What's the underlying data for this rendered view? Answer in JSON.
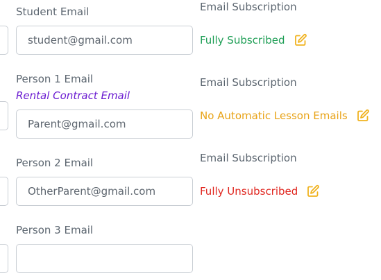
{
  "student": {
    "label": "Student Email",
    "value": "student@gmail.com"
  },
  "person1": {
    "label": "Person 1 Email",
    "sublabel": "Rental Contract Email",
    "value": "Parent@gmail.com"
  },
  "person2": {
    "label": "Person 2 Email",
    "value": "OtherParent@gmail.com"
  },
  "person3": {
    "label": "Person 3 Email",
    "value": ""
  },
  "subscriptions": [
    {
      "title": "Email Subscription",
      "status": "Fully Subscribed",
      "status_color": "#1e9e55",
      "icon": "edit-icon"
    },
    {
      "title": "Email Subscription",
      "status": "No Automatic Lesson Emails",
      "status_color": "#e8a317",
      "icon": "edit-icon"
    },
    {
      "title": "Email Subscription",
      "status": "Fully Unsubscribed",
      "status_color": "#e0261f",
      "icon": "edit-icon"
    }
  ],
  "colors": {
    "edit_icon": "#f0b21e",
    "sublabel": "#6a1bd1"
  }
}
